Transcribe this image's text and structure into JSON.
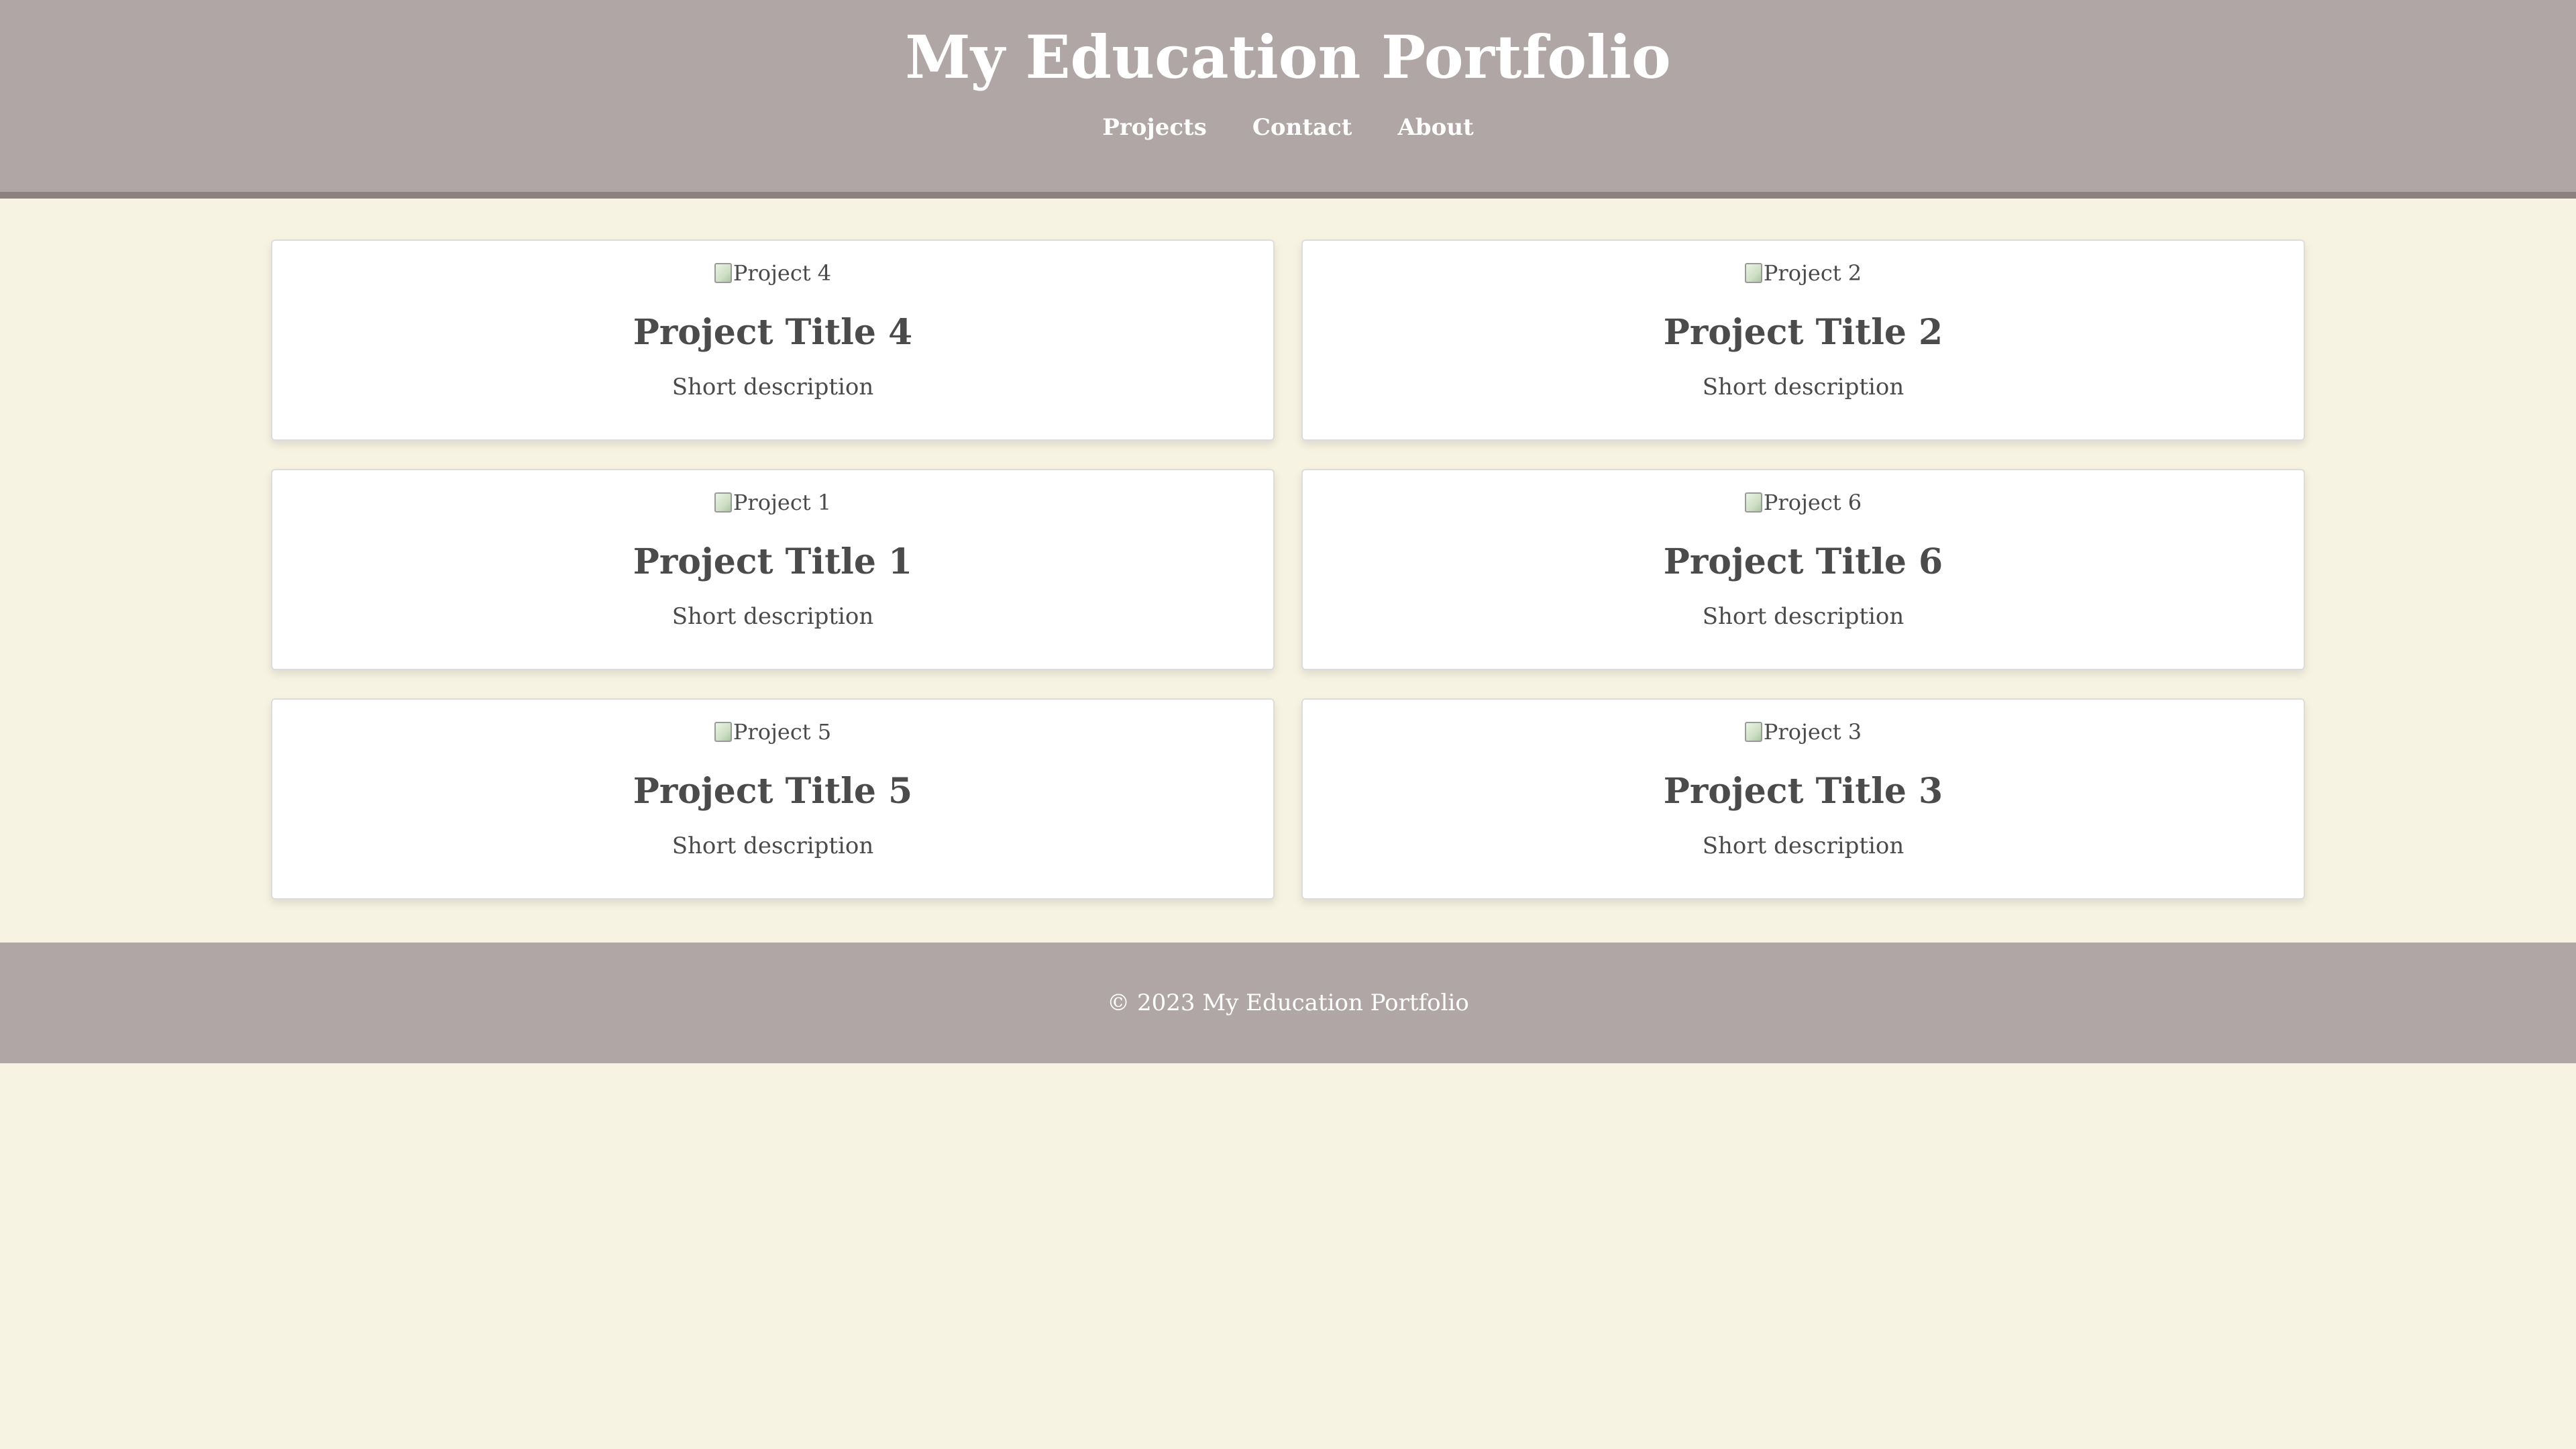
{
  "header": {
    "title": "My Education Portfolio",
    "nav": [
      "Projects",
      "Contact",
      "About"
    ]
  },
  "projects": [
    {
      "image_alt": "Project 4",
      "title": "Project Title 4",
      "description": "Short description"
    },
    {
      "image_alt": "Project 2",
      "title": "Project Title 2",
      "description": "Short description"
    },
    {
      "image_alt": "Project 1",
      "title": "Project Title 1",
      "description": "Short description"
    },
    {
      "image_alt": "Project 6",
      "title": "Project Title 6",
      "description": "Short description"
    },
    {
      "image_alt": "Project 5",
      "title": "Project Title 5",
      "description": "Short description"
    },
    {
      "image_alt": "Project 3",
      "title": "Project Title 3",
      "description": "Short description"
    }
  ],
  "footer": {
    "text": "© 2023 My Education Portfolio"
  },
  "colors": {
    "header_bg": "#b0a6a6",
    "page_bg": "#f7f3e3",
    "card_bg": "#ffffff",
    "text": "#4b4b4b"
  }
}
